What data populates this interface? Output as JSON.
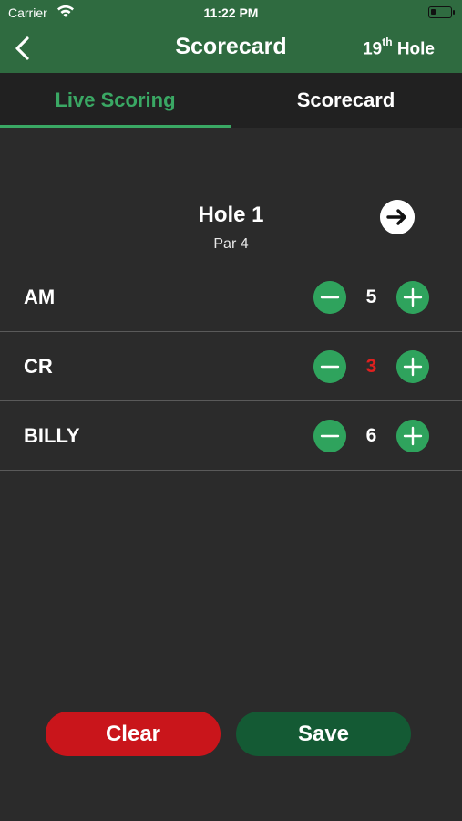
{
  "status_bar": {
    "carrier": "Carrier",
    "time": "11:22 PM"
  },
  "nav": {
    "title": "Scorecard",
    "right_label": "19",
    "right_sup": "th",
    "right_suffix": " Hole"
  },
  "tabs": [
    {
      "label": "Live Scoring",
      "active": true
    },
    {
      "label": "Scorecard",
      "active": false
    }
  ],
  "hole": {
    "title": "Hole 1",
    "par": "Par 4"
  },
  "players": [
    {
      "name": "AM",
      "score": "5",
      "score_color": "#ffffff"
    },
    {
      "name": "CR",
      "score": "3",
      "score_color": "#e0201f"
    },
    {
      "name": "BILLY",
      "score": "6",
      "score_color": "#ffffff"
    }
  ],
  "actions": {
    "clear_label": "Clear",
    "save_label": "Save"
  },
  "colors": {
    "header": "#2f6b40",
    "accent": "#3aa864",
    "button": "#2fa35d",
    "clear": "#c9151b",
    "save": "#145a34"
  }
}
